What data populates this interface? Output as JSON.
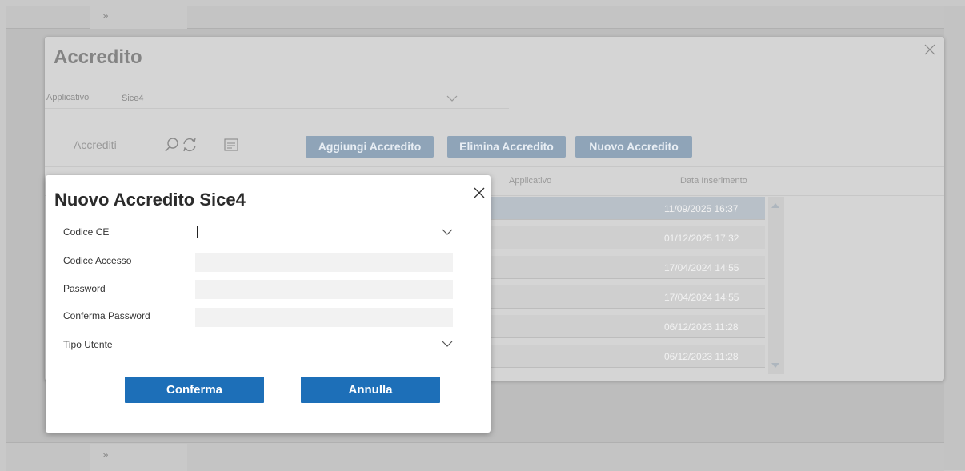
{
  "background": {
    "expand_label": "»"
  },
  "outer_modal": {
    "title": "Accredito",
    "applicativo_label": "Applicativo",
    "applicativo_value": "Sice4",
    "toolbar_label": "Accrediti",
    "buttons": {
      "aggiungi": "Aggiungi Accredito",
      "elimina": "Elimina Accredito",
      "nuovo": "Nuovo Accredito"
    },
    "columns": {
      "applicativo": "Applicativo",
      "data_inserimento": "Data Inserimento"
    },
    "rows": [
      {
        "data": "11/09/2025 16:37"
      },
      {
        "data": "01/12/2025 17:32"
      },
      {
        "data": "17/04/2024 14:55"
      },
      {
        "data": "17/04/2024 14:55"
      },
      {
        "data": "06/12/2023 11:28"
      },
      {
        "data": "06/12/2023 11:28"
      }
    ]
  },
  "dialog": {
    "title": "Nuovo Accredito Sice4",
    "fields": {
      "codice_ce": {
        "label": "Codice CE",
        "value": ""
      },
      "codice_accesso": {
        "label": "Codice Accesso",
        "value": ""
      },
      "password": {
        "label": "Password",
        "value": ""
      },
      "conferma_password": {
        "label": "Conferma Password",
        "value": ""
      },
      "tipo_utente": {
        "label": "Tipo Utente",
        "value": ""
      }
    },
    "confirm_label": "Conferma",
    "cancel_label": "Annulla"
  },
  "colors": {
    "primary_button": "#1d6fb8",
    "dimmed_button": "#8fa4b8",
    "selected_row": "#b8c0c8"
  }
}
